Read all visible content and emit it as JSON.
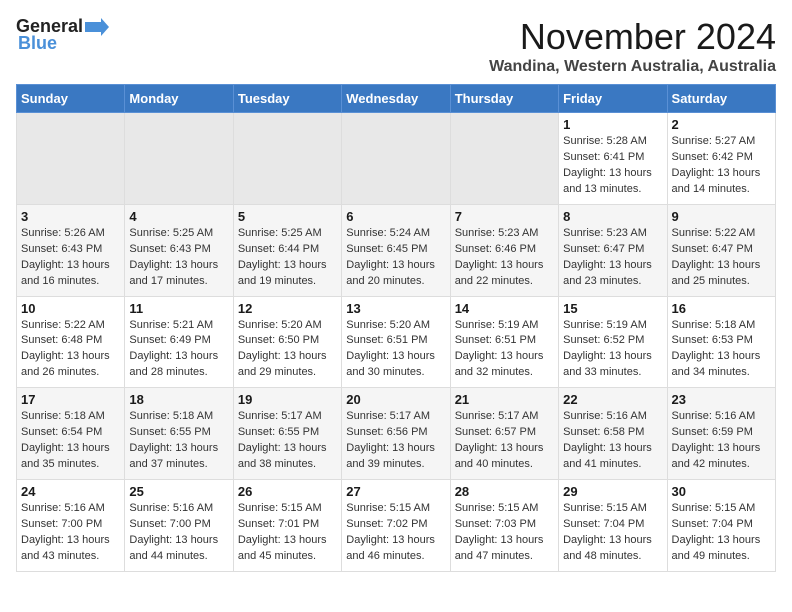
{
  "logo": {
    "general": "General",
    "blue": "Blue"
  },
  "header": {
    "month": "November 2024",
    "location": "Wandina, Western Australia, Australia"
  },
  "days_of_week": [
    "Sunday",
    "Monday",
    "Tuesday",
    "Wednesday",
    "Thursday",
    "Friday",
    "Saturday"
  ],
  "weeks": [
    [
      {
        "day": "",
        "info": ""
      },
      {
        "day": "",
        "info": ""
      },
      {
        "day": "",
        "info": ""
      },
      {
        "day": "",
        "info": ""
      },
      {
        "day": "",
        "info": ""
      },
      {
        "day": "1",
        "info": "Sunrise: 5:28 AM\nSunset: 6:41 PM\nDaylight: 13 hours and 13 minutes."
      },
      {
        "day": "2",
        "info": "Sunrise: 5:27 AM\nSunset: 6:42 PM\nDaylight: 13 hours and 14 minutes."
      }
    ],
    [
      {
        "day": "3",
        "info": "Sunrise: 5:26 AM\nSunset: 6:43 PM\nDaylight: 13 hours and 16 minutes."
      },
      {
        "day": "4",
        "info": "Sunrise: 5:25 AM\nSunset: 6:43 PM\nDaylight: 13 hours and 17 minutes."
      },
      {
        "day": "5",
        "info": "Sunrise: 5:25 AM\nSunset: 6:44 PM\nDaylight: 13 hours and 19 minutes."
      },
      {
        "day": "6",
        "info": "Sunrise: 5:24 AM\nSunset: 6:45 PM\nDaylight: 13 hours and 20 minutes."
      },
      {
        "day": "7",
        "info": "Sunrise: 5:23 AM\nSunset: 6:46 PM\nDaylight: 13 hours and 22 minutes."
      },
      {
        "day": "8",
        "info": "Sunrise: 5:23 AM\nSunset: 6:47 PM\nDaylight: 13 hours and 23 minutes."
      },
      {
        "day": "9",
        "info": "Sunrise: 5:22 AM\nSunset: 6:47 PM\nDaylight: 13 hours and 25 minutes."
      }
    ],
    [
      {
        "day": "10",
        "info": "Sunrise: 5:22 AM\nSunset: 6:48 PM\nDaylight: 13 hours and 26 minutes."
      },
      {
        "day": "11",
        "info": "Sunrise: 5:21 AM\nSunset: 6:49 PM\nDaylight: 13 hours and 28 minutes."
      },
      {
        "day": "12",
        "info": "Sunrise: 5:20 AM\nSunset: 6:50 PM\nDaylight: 13 hours and 29 minutes."
      },
      {
        "day": "13",
        "info": "Sunrise: 5:20 AM\nSunset: 6:51 PM\nDaylight: 13 hours and 30 minutes."
      },
      {
        "day": "14",
        "info": "Sunrise: 5:19 AM\nSunset: 6:51 PM\nDaylight: 13 hours and 32 minutes."
      },
      {
        "day": "15",
        "info": "Sunrise: 5:19 AM\nSunset: 6:52 PM\nDaylight: 13 hours and 33 minutes."
      },
      {
        "day": "16",
        "info": "Sunrise: 5:18 AM\nSunset: 6:53 PM\nDaylight: 13 hours and 34 minutes."
      }
    ],
    [
      {
        "day": "17",
        "info": "Sunrise: 5:18 AM\nSunset: 6:54 PM\nDaylight: 13 hours and 35 minutes."
      },
      {
        "day": "18",
        "info": "Sunrise: 5:18 AM\nSunset: 6:55 PM\nDaylight: 13 hours and 37 minutes."
      },
      {
        "day": "19",
        "info": "Sunrise: 5:17 AM\nSunset: 6:55 PM\nDaylight: 13 hours and 38 minutes."
      },
      {
        "day": "20",
        "info": "Sunrise: 5:17 AM\nSunset: 6:56 PM\nDaylight: 13 hours and 39 minutes."
      },
      {
        "day": "21",
        "info": "Sunrise: 5:17 AM\nSunset: 6:57 PM\nDaylight: 13 hours and 40 minutes."
      },
      {
        "day": "22",
        "info": "Sunrise: 5:16 AM\nSunset: 6:58 PM\nDaylight: 13 hours and 41 minutes."
      },
      {
        "day": "23",
        "info": "Sunrise: 5:16 AM\nSunset: 6:59 PM\nDaylight: 13 hours and 42 minutes."
      }
    ],
    [
      {
        "day": "24",
        "info": "Sunrise: 5:16 AM\nSunset: 7:00 PM\nDaylight: 13 hours and 43 minutes."
      },
      {
        "day": "25",
        "info": "Sunrise: 5:16 AM\nSunset: 7:00 PM\nDaylight: 13 hours and 44 minutes."
      },
      {
        "day": "26",
        "info": "Sunrise: 5:15 AM\nSunset: 7:01 PM\nDaylight: 13 hours and 45 minutes."
      },
      {
        "day": "27",
        "info": "Sunrise: 5:15 AM\nSunset: 7:02 PM\nDaylight: 13 hours and 46 minutes."
      },
      {
        "day": "28",
        "info": "Sunrise: 5:15 AM\nSunset: 7:03 PM\nDaylight: 13 hours and 47 minutes."
      },
      {
        "day": "29",
        "info": "Sunrise: 5:15 AM\nSunset: 7:04 PM\nDaylight: 13 hours and 48 minutes."
      },
      {
        "day": "30",
        "info": "Sunrise: 5:15 AM\nSunset: 7:04 PM\nDaylight: 13 hours and 49 minutes."
      }
    ]
  ]
}
